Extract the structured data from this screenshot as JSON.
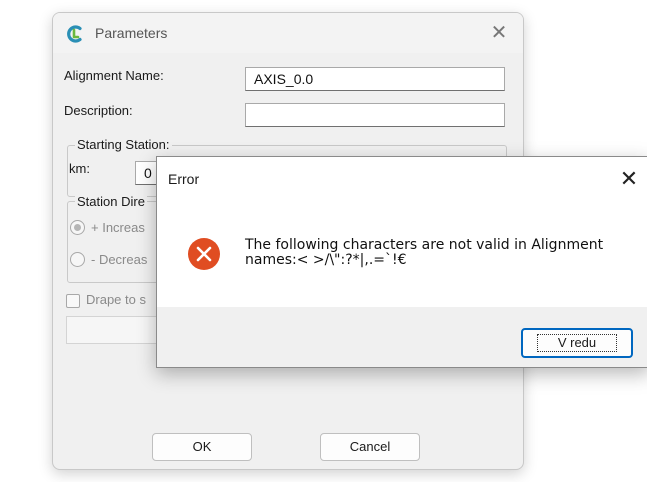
{
  "params": {
    "title": "Parameters",
    "alignment_name_label": "Alignment Name:",
    "alignment_name_value": "AXIS_0.0",
    "description_label": "Description:",
    "description_value": "",
    "starting_station_title": "Starting Station:",
    "km_label": "km:",
    "km_value": "0",
    "station_direction_title": "Station Dire",
    "increase_label": "+ Increas",
    "decrease_label": "- Decreas",
    "drape_label": "Drape to s",
    "ok_label": "OK",
    "cancel_label": "Cancel"
  },
  "error": {
    "title": "Error",
    "message": "The following characters are not valid in Alignment names:< >/\\\":?*|,.=`!€",
    "ok_label": "V redu"
  },
  "colors": {
    "accent": "#0067c0",
    "error_icon": "#e04d22",
    "app_icon": "#2a8fb5"
  }
}
